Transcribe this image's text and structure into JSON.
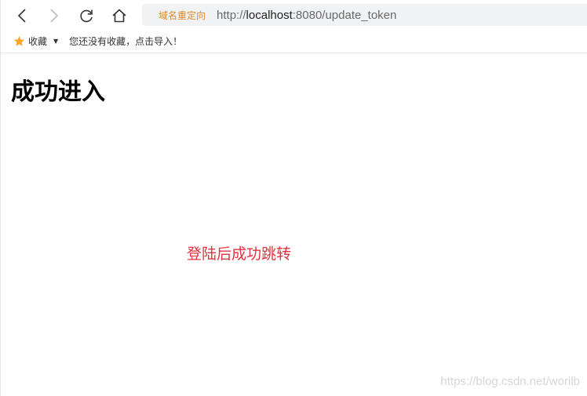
{
  "toolbar": {
    "icons": {
      "back": "chevron-left-icon",
      "forward": "chevron-right-icon",
      "reload": "reload-icon",
      "home": "home-icon"
    }
  },
  "address_bar": {
    "redirect_label": "域名重定向",
    "url_prefix": "http://",
    "url_host": "localhost",
    "url_rest": ":8080/update_token"
  },
  "bookmarks_bar": {
    "favorites_label": "收藏",
    "empty_hint": "您还没有收藏，点击导入！",
    "star_color": "#f5a623"
  },
  "page": {
    "heading": "成功进入",
    "message": "登陆后成功跳转",
    "message_color": "#e2333e"
  },
  "watermark": "https://blog.csdn.net/worilb"
}
